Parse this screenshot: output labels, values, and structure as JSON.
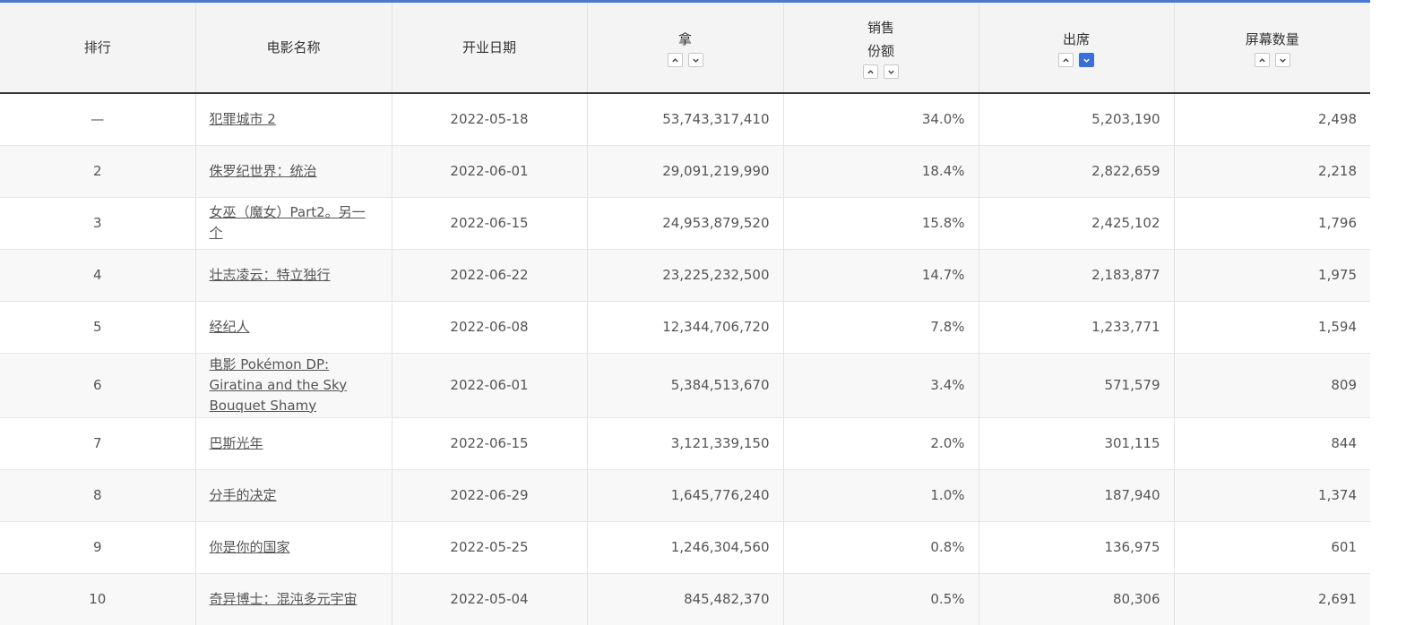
{
  "columns": {
    "rank": "排行",
    "title": "电影名称",
    "open_date": "开业日期",
    "revenue": "拿",
    "share_line1": "销售",
    "share_line2": "份额",
    "attendance": "出席",
    "screens": "屏幕数量"
  },
  "rows": [
    {
      "rank": "—",
      "title": "犯罪城市 2",
      "open_date": "2022-05-18",
      "revenue": "53,743,317,410",
      "share": "34.0%",
      "attendance": "5,203,190",
      "screens": "2,498"
    },
    {
      "rank": "2",
      "title": "侏罗纪世界：统治",
      "open_date": "2022-06-01",
      "revenue": "29,091,219,990",
      "share": "18.4%",
      "attendance": "2,822,659",
      "screens": "2,218"
    },
    {
      "rank": "3",
      "title": "女巫（魔女）Part2。另一个",
      "open_date": "2022-06-15",
      "revenue": "24,953,879,520",
      "share": "15.8%",
      "attendance": "2,425,102",
      "screens": "1,796"
    },
    {
      "rank": "4",
      "title": "壮志凌云：特立独行",
      "open_date": "2022-06-22",
      "revenue": "23,225,232,500",
      "share": "14.7%",
      "attendance": "2,183,877",
      "screens": "1,975"
    },
    {
      "rank": "5",
      "title": "经纪人",
      "open_date": "2022-06-08",
      "revenue": "12,344,706,720",
      "share": "7.8%",
      "attendance": "1,233,771",
      "screens": "1,594"
    },
    {
      "rank": "6",
      "title": "电影 Pokémon DP: Giratina and the Sky Bouquet Shamy",
      "open_date": "2022-06-01",
      "revenue": "5,384,513,670",
      "share": "3.4%",
      "attendance": "571,579",
      "screens": "809"
    },
    {
      "rank": "7",
      "title": "巴斯光年",
      "open_date": "2022-06-15",
      "revenue": "3,121,339,150",
      "share": "2.0%",
      "attendance": "301,115",
      "screens": "844"
    },
    {
      "rank": "8",
      "title": "分手的决定",
      "open_date": "2022-06-29",
      "revenue": "1,645,776,240",
      "share": "1.0%",
      "attendance": "187,940",
      "screens": "1,374"
    },
    {
      "rank": "9",
      "title": "你是你的国家",
      "open_date": "2022-05-25",
      "revenue": "1,246,304,560",
      "share": "0.8%",
      "attendance": "136,975",
      "screens": "601"
    },
    {
      "rank": "10",
      "title": "奇异博士：混沌多元宇宙",
      "open_date": "2022-05-04",
      "revenue": "845,482,370",
      "share": "0.5%",
      "attendance": "80,306",
      "screens": "2,691"
    }
  ],
  "sort": {
    "active_column": "attendance",
    "active_direction": "descending",
    "up_icon": "chevron-up-icon",
    "down_icon": "chevron-down-icon"
  },
  "colors": {
    "accent": "#3c6fd4",
    "header_bg": "#f4f4f4",
    "stripe_bg": "#f8f8f8"
  }
}
